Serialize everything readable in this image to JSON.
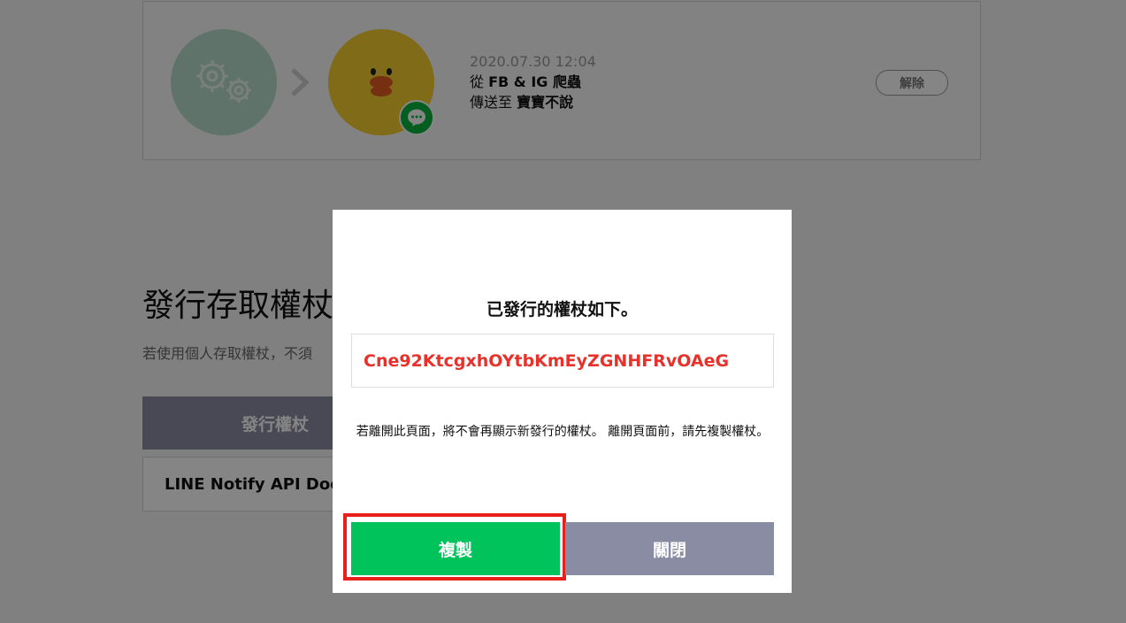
{
  "connection": {
    "date": "2020.07.30 12:04",
    "from_prefix": "從 ",
    "from_service": "FB & IG 爬蟲",
    "to_prefix": "傳送至 ",
    "to_target": "寶寶不說",
    "release_label": "解除",
    "service_icon": "gears-icon",
    "target_icon": "sally-avatar-icon",
    "badge_icon": "line-chat-icon"
  },
  "section": {
    "title": "發行存取權杖",
    "description": "若使用個人存取權杖，不須",
    "issue_button_label": "發行權杖",
    "doc_link_label": "LINE Notify API Doc"
  },
  "modal": {
    "title": "已發行的權杖如下。",
    "token": "Cne92KtcgxhOYtbKmEyZGNHFRvOAeG",
    "note": "若離開此頁面，將不會再顯示新發行的權杖。 離開頁面前，請先複製權杖。",
    "copy_label": "複製",
    "close_label": "關閉"
  },
  "colors": {
    "copy_button": "#00c35c",
    "close_button": "#8a8ca4",
    "token_text": "#e8312a",
    "highlight": "#e8201c"
  }
}
